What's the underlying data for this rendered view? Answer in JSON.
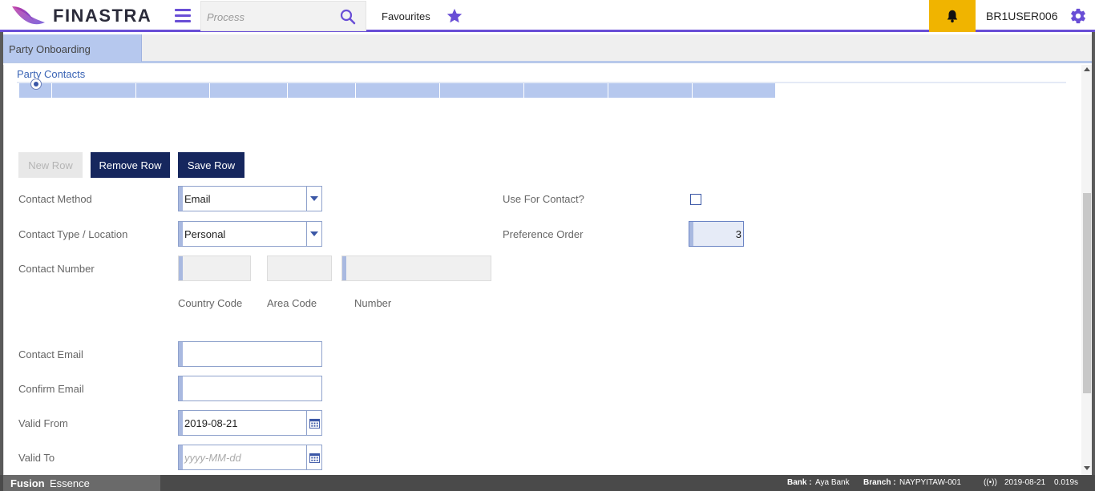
{
  "header": {
    "logo_text": "FINASTRA",
    "search_placeholder": "Process",
    "favourites_label": "Favourites",
    "username": "BR1USER006"
  },
  "tabs": [
    {
      "label": "Party Onboarding",
      "active": true
    }
  ],
  "section": {
    "title": "Party Contacts"
  },
  "buttons": {
    "new_row": "New Row",
    "remove_row": "Remove Row",
    "save_row": "Save Row"
  },
  "form": {
    "contact_method": {
      "label": "Contact Method",
      "value": "Email"
    },
    "contact_type": {
      "label": "Contact Type / Location",
      "value": "Personal"
    },
    "contact_number": {
      "label": "Contact Number",
      "country_code_label": "Country Code",
      "area_code_label": "Area Code",
      "number_label": "Number"
    },
    "contact_email": {
      "label": "Contact Email",
      "value": ""
    },
    "confirm_email": {
      "label": "Confirm Email",
      "value": ""
    },
    "valid_from": {
      "label": "Valid From",
      "value": "2019-08-21"
    },
    "valid_to": {
      "label": "Valid To",
      "placeholder": "yyyy-MM-dd"
    },
    "use_for_contact": {
      "label": "Use For Contact?",
      "checked": false
    },
    "preference_order": {
      "label": "Preference Order",
      "value": "3"
    }
  },
  "footer": {
    "brand_bold": "Fusion",
    "brand_light": "Essence",
    "bank_label": "Bank :",
    "bank_value": "Aya Bank",
    "branch_label": "Branch :",
    "branch_value": "NAYPYITAW-001",
    "signal": "((•))",
    "date": "2019-08-21",
    "time": "0.019s"
  },
  "colors": {
    "accent": "#694ed6",
    "primary_button": "#16275e",
    "notification": "#f0b400",
    "tab_active": "#b6c8ee"
  }
}
